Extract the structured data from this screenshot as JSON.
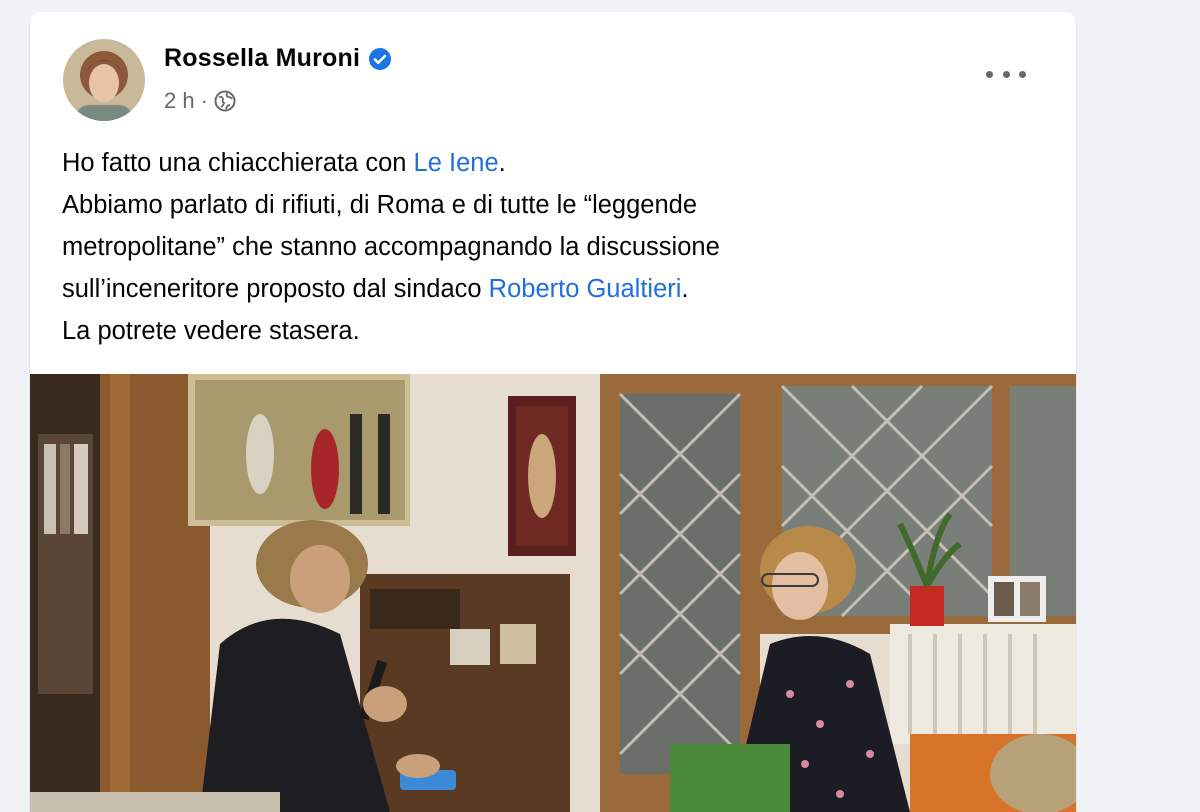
{
  "post": {
    "author_name": "Rossella Muroni",
    "verified_icon": "verified-badge-icon",
    "time": "2 h",
    "separator": "·",
    "audience_icon": "globe-icon",
    "more_icon": "more-options-icon",
    "text": {
      "line1_before": "Ho fatto una chiacchierata con ",
      "line1_link": "Le Iene",
      "line1_after": ".",
      "line2": "Abbiamo parlato di rifiuti, di Roma e di tutte le “leggende",
      "line3": "metropolitane” che stanno accompagnando la discussione",
      "line4_before": "sull’inceneritore proposto dal sindaco ",
      "line4_link": "Roberto Gualtieri",
      "line4_after": ".",
      "line5": "La potrete vedere stasera."
    }
  },
  "colors": {
    "page_bg": "#f0f2f5",
    "card_bg": "#ffffff",
    "link": "#216fdb",
    "verified": "#1b74e4",
    "meta_text": "#65676b"
  }
}
